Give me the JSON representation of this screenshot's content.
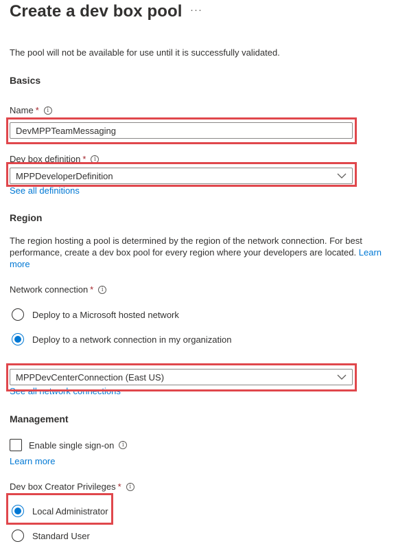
{
  "header": {
    "title": "Create a dev box pool",
    "more_label": "···"
  },
  "intro": "The pool will not be available for use until it is successfully validated.",
  "basics": {
    "heading": "Basics",
    "name_label": "Name",
    "name_value": "DevMPPTeamMessaging",
    "definition_label": "Dev box definition",
    "definition_value": "MPPDeveloperDefinition",
    "definitions_link": "See all definitions"
  },
  "region": {
    "heading": "Region",
    "description": "The region hosting a pool is determined by the region of the network connection. For best performance, create a dev box pool for every region where your developers are located.",
    "learn_more": "Learn more",
    "network_label": "Network connection",
    "options": [
      {
        "label": "Deploy to a Microsoft hosted network",
        "selected": false
      },
      {
        "label": "Deploy to a network connection in my organization",
        "selected": true
      }
    ],
    "connection_value": "MPPDevCenterConnection (East US)",
    "connections_link": "See all network connections"
  },
  "management": {
    "heading": "Management",
    "sso_label": "Enable single sign-on",
    "sso_checked": false,
    "learn_more": "Learn more",
    "privileges_label": "Dev box Creator Privileges",
    "privileges": [
      {
        "label": "Local Administrator",
        "selected": true
      },
      {
        "label": "Standard User",
        "selected": false
      }
    ]
  },
  "required_marker": "*",
  "info_glyph": "i",
  "colors": {
    "accent": "#0078d4",
    "highlight": "#e0474c",
    "required": "#a4262c",
    "text": "#323130"
  },
  "icons": [
    "more-icon",
    "info-icon",
    "chevron-down-icon"
  ]
}
